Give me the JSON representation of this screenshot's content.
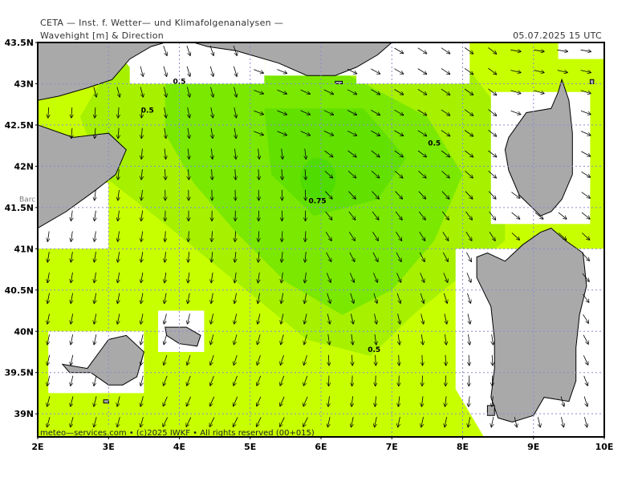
{
  "header": {
    "source": "CETA — Inst. f. Wetter— und Klimafolgenanalysen —",
    "parameter": "Wavehight [m] & Direction",
    "valid_time": "05.07.2025 15 UTC"
  },
  "axes": {
    "lat_labels": [
      "43.5N",
      "43N",
      "42.5N",
      "42N",
      "41.5N",
      "41N",
      "40.5N",
      "40N",
      "39.5N",
      "39N"
    ],
    "lon_labels": [
      "2E",
      "3E",
      "4E",
      "5E",
      "6E",
      "7E",
      "8E",
      "9E",
      "10E"
    ],
    "lat_values": [
      43.5,
      43.0,
      42.5,
      42.0,
      41.5,
      41.0,
      40.5,
      40.0,
      39.5,
      39.0
    ],
    "lon_values": [
      2,
      3,
      4,
      5,
      6,
      7,
      8,
      9,
      10
    ]
  },
  "contour_labels": [
    {
      "text": "0.5",
      "lon": 4.0,
      "lat": 43.0
    },
    {
      "text": "0.5",
      "lon": 3.55,
      "lat": 42.65
    },
    {
      "text": "0.5",
      "lon": 7.6,
      "lat": 42.25
    },
    {
      "text": "0.75",
      "lon": 5.95,
      "lat": 41.55
    },
    {
      "text": "0.5",
      "lon": 6.75,
      "lat": 39.75
    }
  ],
  "places": [
    {
      "name": "Barc",
      "lon": 2.0,
      "lat": 41.6
    }
  ],
  "colors": {
    "land": "#a9a9a9",
    "sea_low": "#c8ff00",
    "sea_mid": "#a6f000",
    "sea_high": "#7ae800",
    "sea_peak": "#4fdc00",
    "grid": "#8b8bcf"
  },
  "footer": {
    "copyright": "meteo—services.com • (c)2025 IWKF • All rights reserved (00+015)"
  }
}
